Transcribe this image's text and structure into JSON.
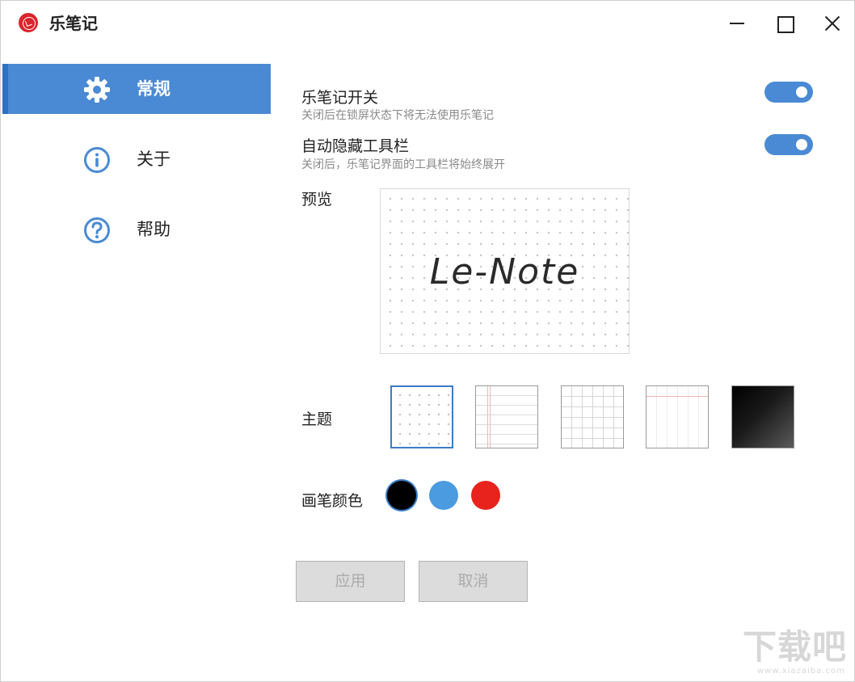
{
  "window": {
    "title": "乐笔记",
    "controls": [
      "minimize-icon",
      "maximize-icon",
      "close-icon"
    ]
  },
  "sidebar": {
    "items": [
      {
        "label": "常规",
        "icon": "gear-icon",
        "active": true
      },
      {
        "label": "关于",
        "icon": "info-icon",
        "active": false
      },
      {
        "label": "帮助",
        "icon": "help-icon",
        "active": false
      }
    ]
  },
  "settings": {
    "enable": {
      "title": "乐笔记开关",
      "desc": "关闭后在锁屏状态下将无法使用乐笔记",
      "on": true
    },
    "autohide": {
      "title": "自动隐藏工具栏",
      "desc": "关闭后，乐笔记界面的工具栏将始终展开",
      "on": true
    }
  },
  "preview": {
    "label": "预览",
    "sample_text": "Le-Note"
  },
  "theme": {
    "label": "主题",
    "options": [
      "dots",
      "lined",
      "grid",
      "columns",
      "dark"
    ],
    "selected": "dots"
  },
  "pen_color": {
    "label": "画笔颜色",
    "options": [
      "#000000",
      "#4a9be0",
      "#e8221c"
    ],
    "selected": "#000000"
  },
  "buttons": {
    "apply": "应用",
    "cancel": "取消"
  },
  "colors": {
    "accent": "#4a8ad4",
    "accent_dark": "#2f6fc4",
    "logo": "#d9252b"
  },
  "watermark": {
    "big": "下载吧",
    "small": "www.xiazaiba.com"
  }
}
